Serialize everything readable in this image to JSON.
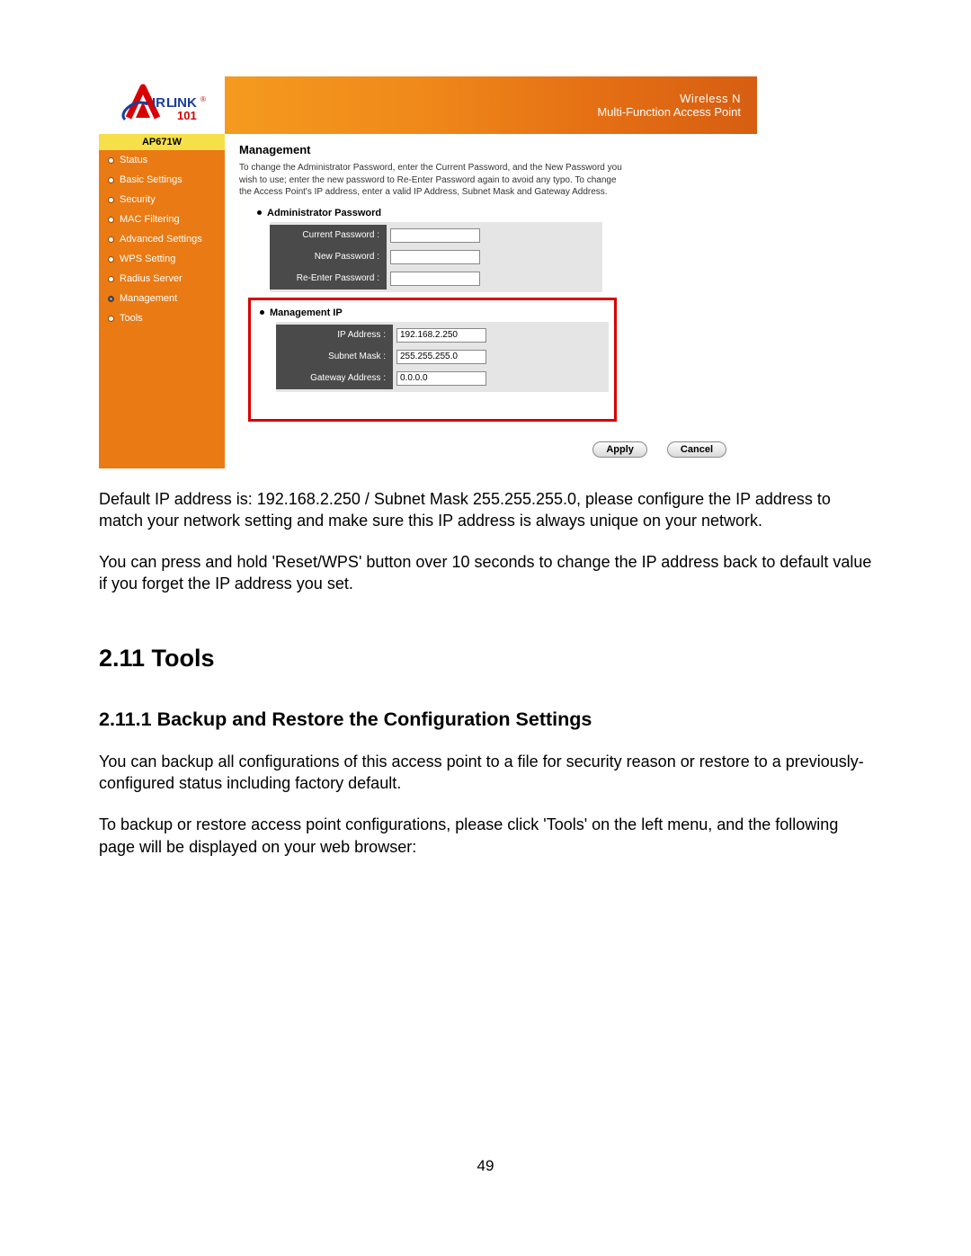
{
  "router": {
    "banner": {
      "line1": "Wireless N",
      "line2": "Multi-Function Access Point"
    },
    "model": "AP671W",
    "nav": [
      {
        "label": "Status",
        "active": false
      },
      {
        "label": "Basic Settings",
        "active": false
      },
      {
        "label": "Security",
        "active": false
      },
      {
        "label": "MAC Filtering",
        "active": false
      },
      {
        "label": "Advanced Settings",
        "active": false
      },
      {
        "label": "WPS Setting",
        "active": false
      },
      {
        "label": "Radius Server",
        "active": false
      },
      {
        "label": "Management",
        "active": true
      },
      {
        "label": "Tools",
        "active": false
      }
    ],
    "section": {
      "title": "Management",
      "desc": "To change the Administrator Password, enter the Current Password, and the New Password you wish to use; enter the new password to Re-Enter Password again to avoid any typo. To change the Access Point's IP address, enter a valid IP Address, Subnet Mask and Gateway Address."
    },
    "admin_pw": {
      "title": "Administrator Password",
      "fields": [
        {
          "label": "Current Password :",
          "value": ""
        },
        {
          "label": "New Password :",
          "value": ""
        },
        {
          "label": "Re-Enter Password :",
          "value": ""
        }
      ]
    },
    "mgmt_ip": {
      "title": "Management IP",
      "fields": [
        {
          "label": "IP Address :",
          "value": "192.168.2.250"
        },
        {
          "label": "Subnet Mask :",
          "value": "255.255.255.0"
        },
        {
          "label": "Gateway Address :",
          "value": "0.0.0.0"
        }
      ]
    },
    "buttons": {
      "apply": "Apply",
      "cancel": "Cancel"
    }
  },
  "doc": {
    "p1": "Default IP address is: 192.168.2.250 / Subnet Mask 255.255.255.0, please configure the IP address to match your network setting and make sure this IP address is always unique on your network.",
    "p2": "You can press and hold 'Reset/WPS' button over 10 seconds to change the IP address back to default value if you forget the IP address you set.",
    "h2": "2.11 Tools",
    "h3": "2.11.1 Backup and Restore the Configuration Settings",
    "p3": "You can backup all configurations of this access point to a file for security reason or restore to a previously-configured status including factory default.",
    "p4": "To backup or restore access point configurations, please click 'Tools' on the left menu, and the following page will be displayed on your web browser:",
    "page_num": "49"
  }
}
